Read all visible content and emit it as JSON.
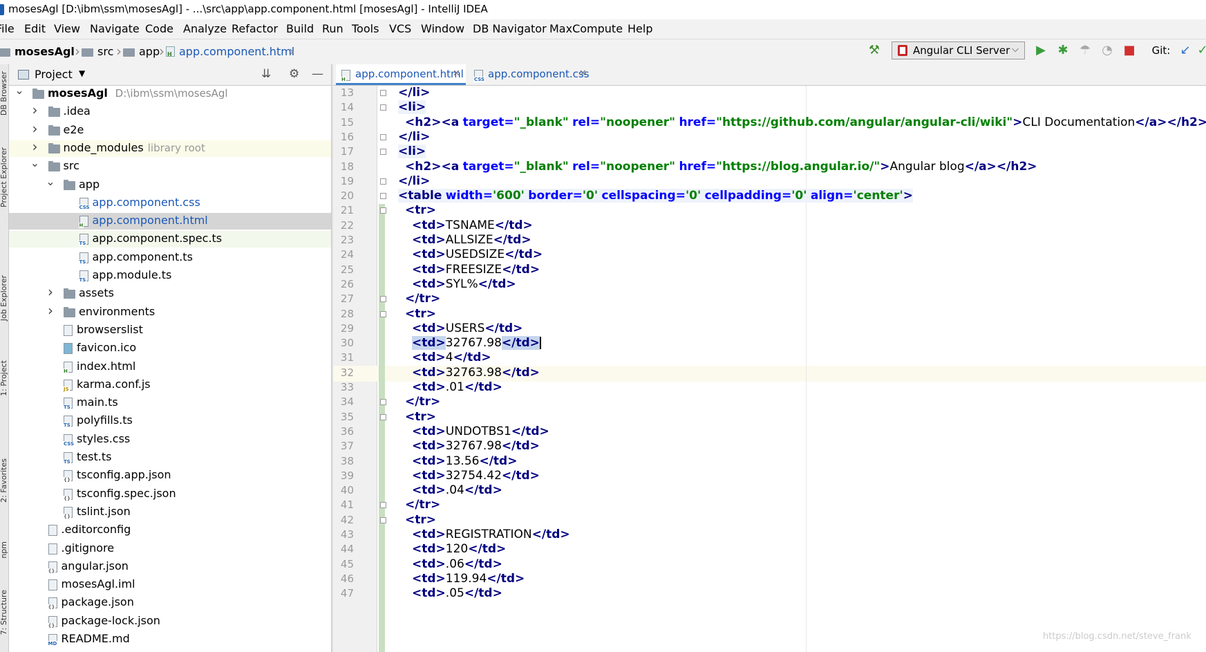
{
  "window": {
    "title": "mosesAgl [D:\\ibm\\ssm\\mosesAgl] - ...\\src\\app\\app.component.html [mosesAgl] - IntelliJ IDEA"
  },
  "menu": [
    "File",
    "Edit",
    "View",
    "Navigate",
    "Code",
    "Analyze",
    "Refactor",
    "Build",
    "Run",
    "Tools",
    "VCS",
    "Window",
    "DB Navigator",
    "MaxCompute",
    "Help"
  ],
  "breadcrumb": [
    "mosesAgl",
    "src",
    "app",
    "app.component.html"
  ],
  "toolbar": {
    "run_config": "Angular CLI Server",
    "git_label": "Git:",
    "icons": [
      "hammer-icon",
      "run-icon",
      "debug-icon",
      "coverage-icon",
      "profile-icon",
      "stop-icon",
      "git-update-icon",
      "git-commit-icon"
    ]
  },
  "side_tabs": [
    "DB Browser",
    "Project Explorer",
    "Job Explorer",
    "1: Project",
    "2: Favorites",
    "npm",
    "7: Structure"
  ],
  "project_panel": {
    "title": "Project",
    "root_name": "mosesAgl",
    "root_path": "D:\\ibm\\ssm\\mosesAgl",
    "library_hint": "library root",
    "items": [
      {
        "name": "mosesAgl",
        "kind": "root",
        "depth": 0,
        "expanded": true
      },
      {
        "name": ".idea",
        "kind": "folder",
        "depth": 1,
        "expanded": false
      },
      {
        "name": "e2e",
        "kind": "folder",
        "depth": 1,
        "expanded": false
      },
      {
        "name": "node_modules",
        "kind": "library",
        "depth": 1,
        "expanded": false
      },
      {
        "name": "src",
        "kind": "folder",
        "depth": 1,
        "expanded": true
      },
      {
        "name": "app",
        "kind": "folder",
        "depth": 2,
        "expanded": true
      },
      {
        "name": "app.component.css",
        "kind": "css",
        "depth": 3,
        "tag": "CSS"
      },
      {
        "name": "app.component.html",
        "kind": "html",
        "depth": 3,
        "tag": "H",
        "selected": true
      },
      {
        "name": "app.component.spec.ts",
        "kind": "ts",
        "depth": 3,
        "tag": "TS"
      },
      {
        "name": "app.component.ts",
        "kind": "ts",
        "depth": 3,
        "tag": "TS"
      },
      {
        "name": "app.module.ts",
        "kind": "ts",
        "depth": 3,
        "tag": "TS"
      },
      {
        "name": "assets",
        "kind": "folder",
        "depth": 2,
        "expanded": false
      },
      {
        "name": "environments",
        "kind": "folder",
        "depth": 2,
        "expanded": false
      },
      {
        "name": "browserslist",
        "kind": "text",
        "depth": 2
      },
      {
        "name": "favicon.ico",
        "kind": "image",
        "depth": 2
      },
      {
        "name": "index.html",
        "kind": "html",
        "depth": 2,
        "tag": "H"
      },
      {
        "name": "karma.conf.js",
        "kind": "js",
        "depth": 2,
        "tag": "JS"
      },
      {
        "name": "main.ts",
        "kind": "ts",
        "depth": 2,
        "tag": "TS"
      },
      {
        "name": "polyfills.ts",
        "kind": "ts",
        "depth": 2,
        "tag": "TS"
      },
      {
        "name": "styles.css",
        "kind": "css",
        "depth": 2,
        "tag": "CSS"
      },
      {
        "name": "test.ts",
        "kind": "ts",
        "depth": 2,
        "tag": "TS"
      },
      {
        "name": "tsconfig.app.json",
        "kind": "json",
        "depth": 2,
        "tag": "{}"
      },
      {
        "name": "tsconfig.spec.json",
        "kind": "json",
        "depth": 2,
        "tag": "{}"
      },
      {
        "name": "tslint.json",
        "kind": "json",
        "depth": 2,
        "tag": "{}"
      },
      {
        "name": ".editorconfig",
        "kind": "text",
        "depth": 1
      },
      {
        "name": ".gitignore",
        "kind": "text",
        "depth": 1
      },
      {
        "name": "angular.json",
        "kind": "json",
        "depth": 1,
        "tag": "{}"
      },
      {
        "name": "mosesAgl.iml",
        "kind": "text",
        "depth": 1
      },
      {
        "name": "package.json",
        "kind": "json",
        "depth": 1,
        "tag": "{}"
      },
      {
        "name": "package-lock.json",
        "kind": "json",
        "depth": 1,
        "tag": "{}"
      },
      {
        "name": "README.md",
        "kind": "md",
        "depth": 1,
        "tag": "MD"
      }
    ]
  },
  "editor": {
    "tabs": [
      {
        "name": "app.component.html",
        "active": true,
        "tag": "H"
      },
      {
        "name": "app.component.css",
        "active": false,
        "tag": "CSS"
      }
    ],
    "lines": [
      {
        "n": 13,
        "indent": 0,
        "code": "</li>"
      },
      {
        "n": 14,
        "indent": 0,
        "code": "<li>"
      },
      {
        "n": 15,
        "indent": 1,
        "code": "<h2><a target=\"_blank\" rel=\"noopener\" href=\"https://github.com/angular/angular-cli/wiki\">CLI Documentation</a></h2>"
      },
      {
        "n": 16,
        "indent": 0,
        "code": "</li>"
      },
      {
        "n": 17,
        "indent": 0,
        "code": "<li>"
      },
      {
        "n": 18,
        "indent": 1,
        "code": "<h2><a target=\"_blank\" rel=\"noopener\" href=\"https://blog.angular.io/\">Angular blog</a></h2>"
      },
      {
        "n": 19,
        "indent": 0,
        "code": "</li>"
      },
      {
        "n": 20,
        "indent": 0,
        "code": "<table width='600' border='0' cellspacing='0' cellpadding='0' align='center'>"
      },
      {
        "n": 21,
        "indent": 1,
        "code": "<tr>"
      },
      {
        "n": 22,
        "indent": 2,
        "code": "<td>TSNAME</td>"
      },
      {
        "n": 23,
        "indent": 2,
        "code": "<td>ALLSIZE</td>"
      },
      {
        "n": 24,
        "indent": 2,
        "code": "<td>USEDSIZE</td>"
      },
      {
        "n": 25,
        "indent": 2,
        "code": "<td>FREESIZE</td>"
      },
      {
        "n": 26,
        "indent": 2,
        "code": "<td>SYL%</td>"
      },
      {
        "n": 27,
        "indent": 1,
        "code": "</tr>"
      },
      {
        "n": 28,
        "indent": 1,
        "code": "<tr>"
      },
      {
        "n": 29,
        "indent": 2,
        "code": "<td>USERS</td>"
      },
      {
        "n": 30,
        "indent": 2,
        "code": "<td>32767.98</td>",
        "current": true
      },
      {
        "n": 31,
        "indent": 2,
        "code": "<td>4</td>"
      },
      {
        "n": 32,
        "indent": 2,
        "code": "<td>32763.98</td>"
      },
      {
        "n": 33,
        "indent": 2,
        "code": "<td>.01</td>"
      },
      {
        "n": 34,
        "indent": 1,
        "code": "</tr>"
      },
      {
        "n": 35,
        "indent": 1,
        "code": "<tr>"
      },
      {
        "n": 36,
        "indent": 2,
        "code": "<td>UNDOTBS1</td>"
      },
      {
        "n": 37,
        "indent": 2,
        "code": "<td>32767.98</td>"
      },
      {
        "n": 38,
        "indent": 2,
        "code": "<td>13.56</td>"
      },
      {
        "n": 39,
        "indent": 2,
        "code": "<td>32754.42</td>"
      },
      {
        "n": 40,
        "indent": 2,
        "code": "<td>.04</td>"
      },
      {
        "n": 41,
        "indent": 1,
        "code": "</tr>"
      },
      {
        "n": 42,
        "indent": 1,
        "code": "<tr>"
      },
      {
        "n": 43,
        "indent": 2,
        "code": "<td>REGISTRATION</td>"
      },
      {
        "n": 44,
        "indent": 2,
        "code": "<td>120</td>"
      },
      {
        "n": 45,
        "indent": 2,
        "code": "<td>.06</td>"
      },
      {
        "n": 46,
        "indent": 2,
        "code": "<td>119.94</td>"
      },
      {
        "n": 47,
        "indent": 2,
        "code": "<td>.05</td>"
      }
    ]
  },
  "watermark": "https://blog.csdn.net/steve_frank",
  "colors": {
    "tag": "#000080",
    "attr": "#0000ff",
    "value": "#008000",
    "accent": "#4083c9"
  }
}
